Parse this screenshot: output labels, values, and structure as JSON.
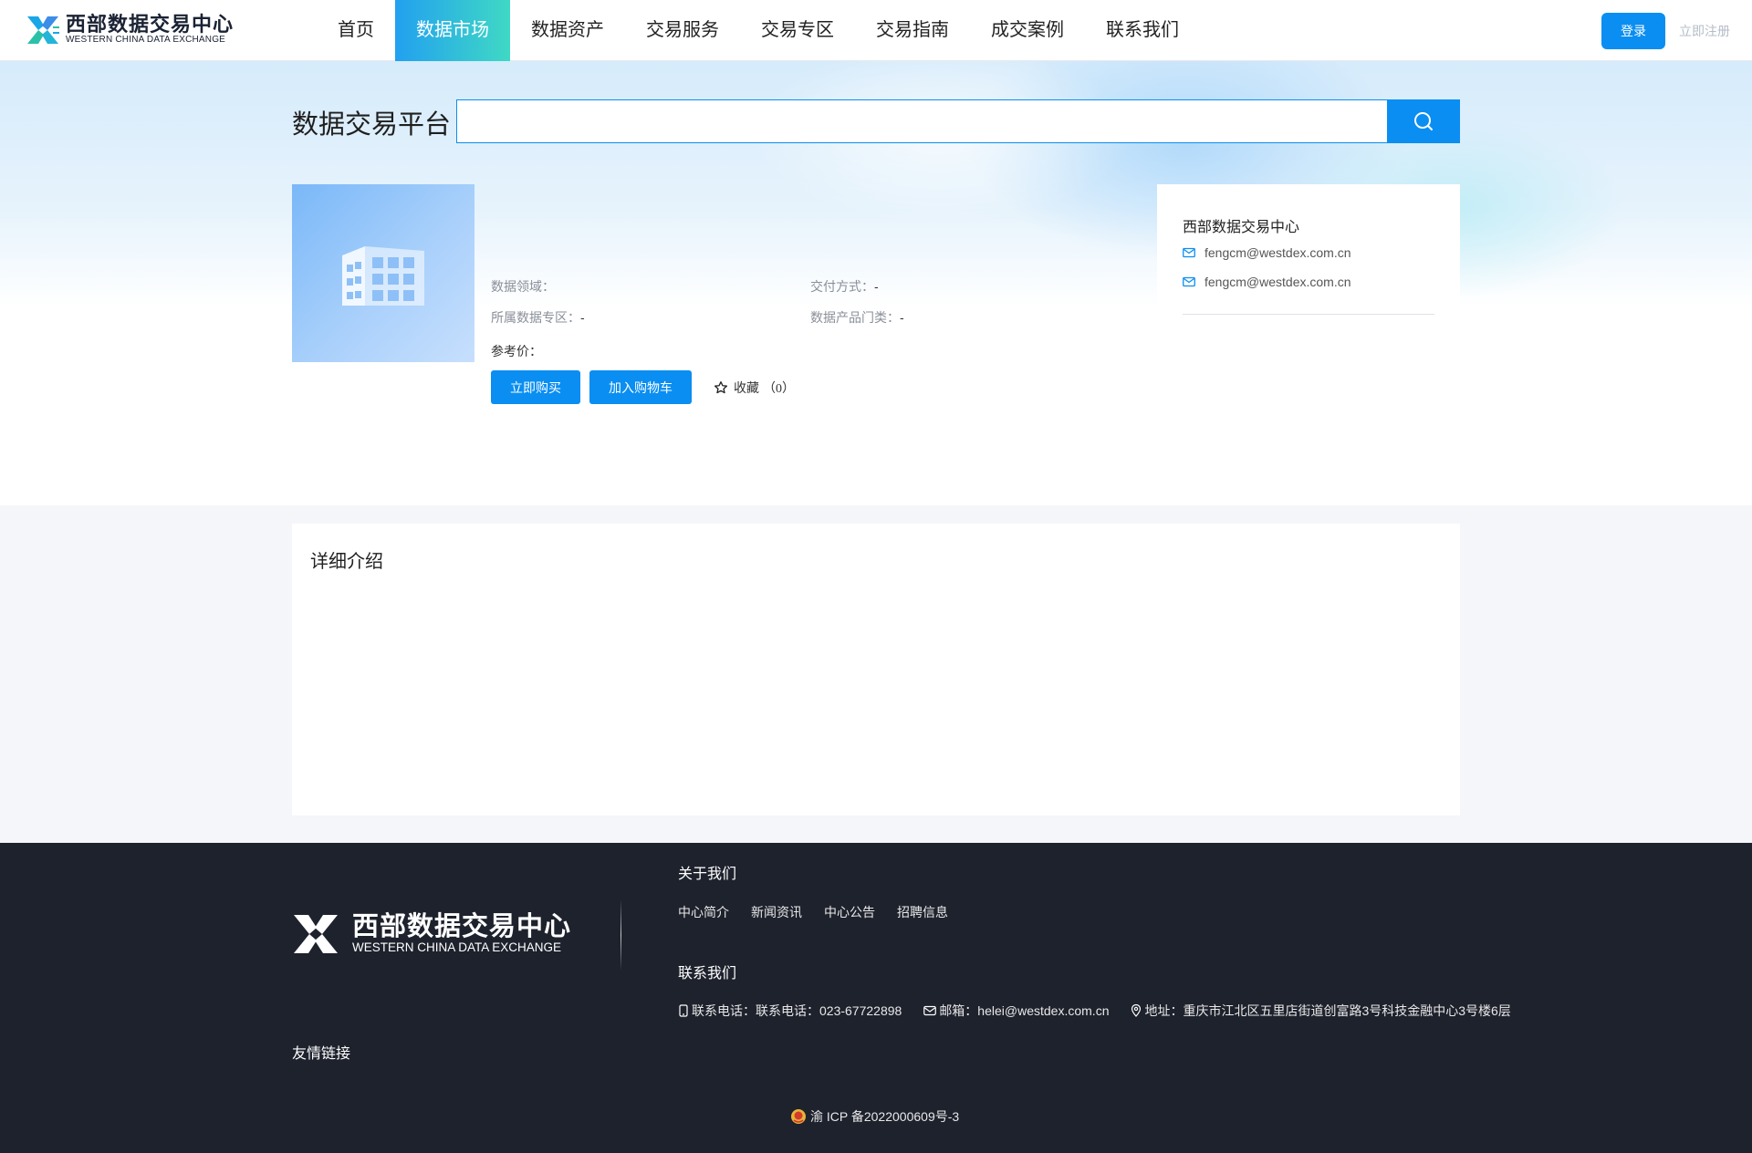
{
  "header": {
    "logo_cn": "西部数据交易中心",
    "logo_en": "WESTERN CHINA DATA EXCHANGE",
    "nav": [
      {
        "label": "首页",
        "active": false
      },
      {
        "label": "数据市场",
        "active": true
      },
      {
        "label": "数据资产",
        "active": false
      },
      {
        "label": "交易服务",
        "active": false
      },
      {
        "label": "交易专区",
        "active": false
      },
      {
        "label": "交易指南",
        "active": false
      },
      {
        "label": "成交案例",
        "active": false
      },
      {
        "label": "联系我们",
        "active": false
      }
    ],
    "login_label": "登录",
    "register_label": "立即注册"
  },
  "search": {
    "title": "数据交易平台",
    "value": "",
    "icon": "search-icon"
  },
  "product": {
    "image_icon": "building-icon",
    "fields": {
      "domain_label": "数据领域：",
      "domain_value": "",
      "delivery_label": "交付方式：",
      "delivery_value": "-",
      "zone_label": "所属数据专区：",
      "zone_value": "-",
      "category_label": "数据产品门类：",
      "category_value": "-"
    },
    "ref_price_label": "参考价：",
    "buy_label": "立即购买",
    "cart_label": "加入购物车",
    "favorite_label": "收藏",
    "favorite_count": "（0）"
  },
  "provider": {
    "name": "西部数据交易中心",
    "emails": [
      "fengcm@westdex.com.cn",
      "fengcm@westdex.com.cn"
    ]
  },
  "detail": {
    "title": "详细介绍"
  },
  "footer": {
    "logo_cn": "西部数据交易中心",
    "logo_en": "WESTERN CHINA DATA EXCHANGE",
    "about_title": "关于我们",
    "about_links": [
      "中心简介",
      "新闻资讯",
      "中心公告",
      "招聘信息"
    ],
    "contact_title": "联系我们",
    "phone": "联系电话：联系电话：023-67722898",
    "email": "邮箱：helei@westdex.com.cn",
    "address": "地址：重庆市江北区五里店街道创富路3号科技金融中心3号楼6层",
    "friend_links_title": "友情链接",
    "icp": "渝 ICP 备2022000609号-3"
  },
  "colors": {
    "primary": "#0a8ef2",
    "nav_active_start": "#22a0f0",
    "nav_active_end": "#3fd9c4",
    "footer_bg": "#1e222d"
  }
}
